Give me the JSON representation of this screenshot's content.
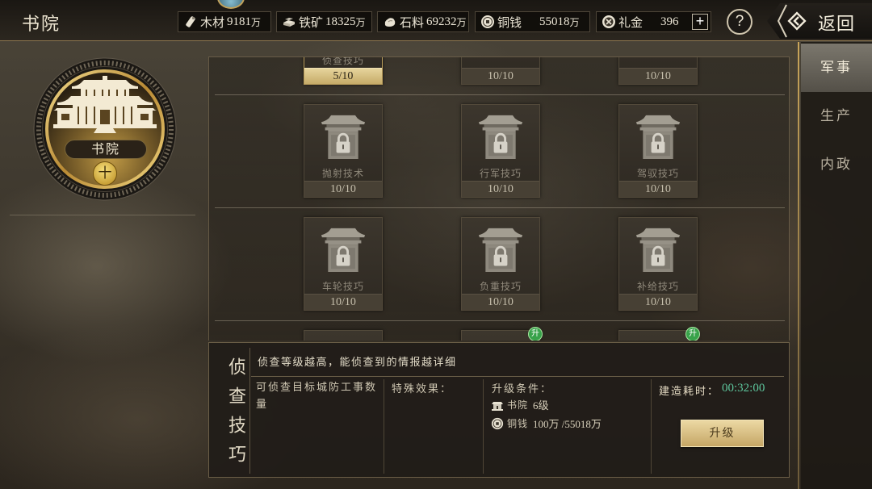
{
  "header": {
    "title": "书院",
    "resources": [
      {
        "icon": "wood-icon",
        "label": "木材",
        "amount": "9181",
        "unit": "万"
      },
      {
        "icon": "iron-ore-icon",
        "label": "铁矿",
        "amount": "18325",
        "unit": "万"
      },
      {
        "icon": "stone-icon",
        "label": "石料",
        "amount": "69232",
        "unit": "万"
      },
      {
        "icon": "copper-coin-icon",
        "label": "铜钱",
        "amount": "55018",
        "unit": "万"
      },
      {
        "icon": "gift-money-icon",
        "label": "礼金",
        "amount": "396"
      }
    ],
    "add_label": "+",
    "help_label": "?",
    "back_label": "返回"
  },
  "building": {
    "icon": "academy-building-icon",
    "name": "书院",
    "level_badge": "十"
  },
  "tabs": [
    {
      "label": "军事",
      "active": true
    },
    {
      "label": "生产",
      "active": false
    },
    {
      "label": "内政",
      "active": false
    }
  ],
  "techs": {
    "rows": [
      [
        {
          "name": "侦查技巧",
          "level": "5/10",
          "selected": true
        },
        {
          "level": "10/10"
        },
        {
          "level": "10/10"
        }
      ],
      [
        {
          "name": "抛射技术",
          "level": "10/10",
          "icon": "locked-tower-icon"
        },
        {
          "name": "行军技巧",
          "level": "10/10",
          "icon": "locked-tower-icon"
        },
        {
          "name": "驾驭技巧",
          "level": "10/10",
          "icon": "locked-tower-icon"
        }
      ],
      [
        {
          "name": "车轮技巧",
          "level": "10/10",
          "icon": "locked-tower-icon"
        },
        {
          "name": "负重技巧",
          "level": "10/10",
          "icon": "locked-tower-icon"
        },
        {
          "name": "补给技巧",
          "level": "10/10",
          "icon": "locked-tower-icon"
        }
      ],
      [
        {},
        {
          "badge": "升"
        },
        {
          "badge": "升"
        }
      ]
    ]
  },
  "detail": {
    "title": "侦查技巧",
    "description": "侦查等级越高，能侦查到的情报越详细",
    "effect": "可侦查目标城防工事数量",
    "special_label": "特殊效果：",
    "requirements_label": "升级条件：",
    "requirements": [
      {
        "icon": "academy-small-icon",
        "label": "书院",
        "value": "6级"
      },
      {
        "icon": "copper-coin-icon",
        "label": "铜钱",
        "value": "100万 /55018万"
      }
    ],
    "build_time_label": "建造耗时：",
    "build_time": "00:32:00",
    "upgrade_button": "升级"
  },
  "colors": {
    "accent_gold": "#c9a55a",
    "time_green": "#5dc59c",
    "badge_green": "#38a24a",
    "selected_level_bg": "#e6d49c"
  }
}
